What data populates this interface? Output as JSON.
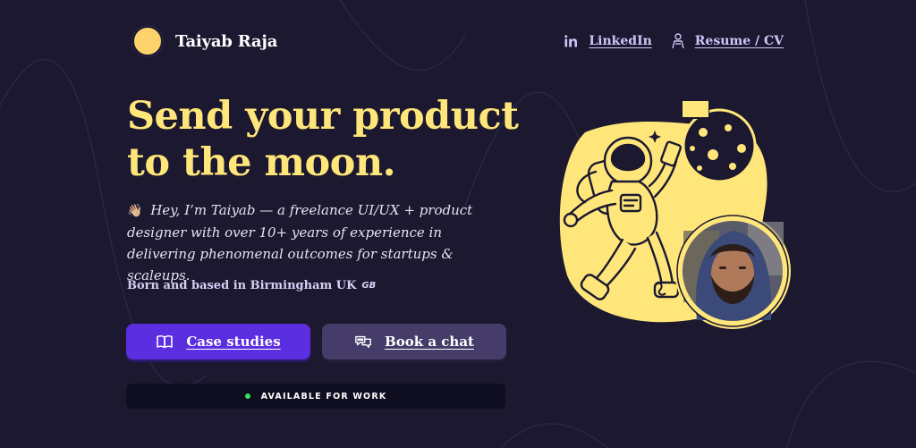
{
  "brand": {
    "name": "Taiyab Raja"
  },
  "nav": {
    "linkedin_label": "LinkedIn",
    "resume_label": "Resume / CV"
  },
  "hero": {
    "title_line1": "Send your product",
    "title_line2": "to the moon.",
    "intro_wave": "👋🏼",
    "intro_text": "Hey, I’m Taiyab — a freelance UI/UX + product designer with over 10+ years of experience in delivering phenomenal outcomes for startups & scaleups.",
    "location_text": "Born and based in Birmingham UK",
    "location_flag": "GB"
  },
  "buttons": {
    "case_studies_label": "Case studies",
    "book_chat_label": "Book a chat"
  },
  "availability": {
    "label": "AVAILABLE FOR WORK"
  },
  "colors": {
    "background": "#1b1830",
    "accent_yellow": "#ffe67a",
    "primary_button": "#5b2ee0",
    "secondary_button": "#463c69",
    "status_green": "#35e05a"
  },
  "icons": {
    "linkedin": "linkedin-icon",
    "resume": "person-icon",
    "case_studies": "book-open-icon",
    "book_chat": "chat-bubbles-icon"
  }
}
